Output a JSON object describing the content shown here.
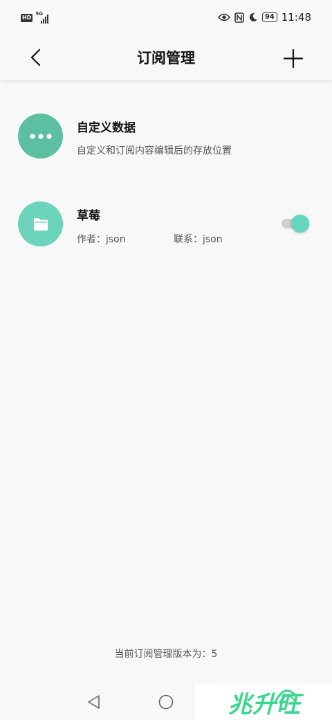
{
  "status_bar": {
    "hd_label": "HD",
    "network_label": "5G",
    "time": "11:48",
    "battery_level": "94",
    "icons": [
      "hd-icon",
      "signal-icon",
      "eye-icon",
      "nfc-icon",
      "moon-icon",
      "battery-icon"
    ]
  },
  "app_bar": {
    "title": "订阅管理",
    "back_icon": "back-arrow-icon",
    "add_icon": "plus-icon"
  },
  "items": [
    {
      "icon": "more-dots-icon",
      "icon_color": "#5dbfa1",
      "title": "自定义数据",
      "subtitle": "自定义和订阅内容编辑后的存放位置"
    },
    {
      "icon": "folder-icon",
      "icon_color": "#6dd4bc",
      "title": "草莓",
      "author": "作者：json",
      "contact": "联系：json",
      "enabled": true
    }
  ],
  "footer": {
    "version_text": "当前订阅管理版本为：5"
  },
  "nav_bar": {
    "icons": [
      "nav-back-icon",
      "nav-home-icon"
    ]
  },
  "watermark": {
    "text": "兆升旺"
  },
  "colors": {
    "accent": "#64d6bd",
    "background": "#f8f8f8",
    "watermark": "#3bd68e"
  }
}
